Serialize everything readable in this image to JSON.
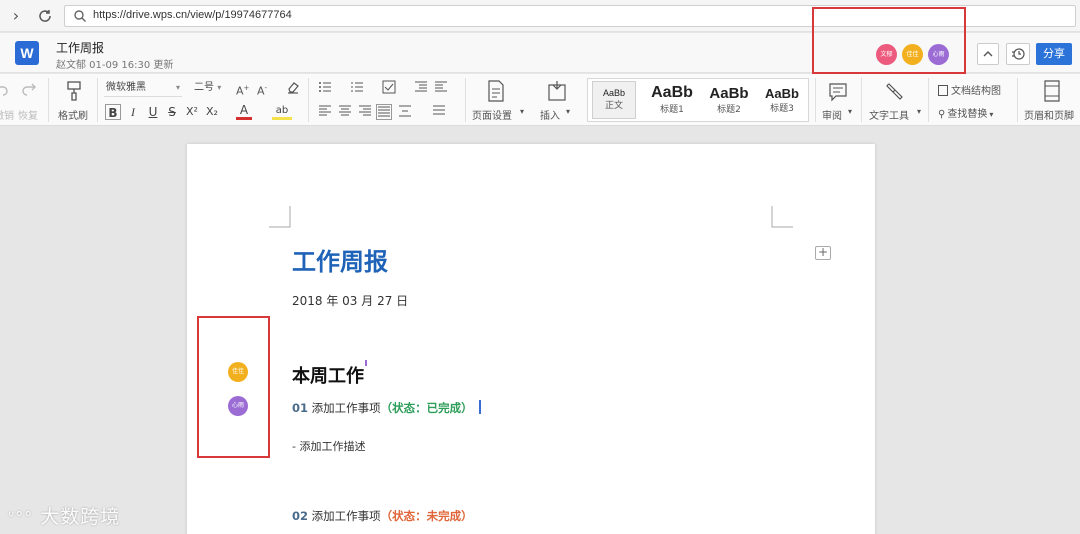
{
  "browser": {
    "url": "https://drive.wps.cn/view/p/19974677764"
  },
  "titlebar": {
    "app_logo": "W",
    "doc_title": "工作周报",
    "doc_meta": "赵文郁 01-09 16:30 更新",
    "share_label": "分享",
    "avatars": [
      {
        "label": "文郁",
        "color": "#ec5b7e"
      },
      {
        "label": "佳佳",
        "color": "#f2b01e"
      },
      {
        "label": "心雨",
        "color": "#9b6cd4"
      }
    ]
  },
  "ribbon": {
    "undo_label": "撤销",
    "redo_label": "恢复",
    "format_painter_label": "格式刷",
    "font_name": "微软雅黑",
    "font_size": "二号",
    "page_setup_label": "页面设置",
    "insert_label": "插入",
    "review_label": "审阅",
    "text_tools_label": "文字工具",
    "doc_structure_label": "文档结构图",
    "find_replace_label": "查找替换",
    "header_footer_label": "页眉和页脚",
    "styles": [
      {
        "preview": "AaBb",
        "name": "正文"
      },
      {
        "preview": "AaBb",
        "name": "标题1"
      },
      {
        "preview": "AaBb",
        "name": "标题2"
      },
      {
        "preview": "AaBb",
        "name": "标题3"
      }
    ]
  },
  "document": {
    "title": "工作周报",
    "date": "2018 年 03 月 27 日",
    "section_heading": "本周工作",
    "items": [
      {
        "num": "01",
        "text": "添加工作事项",
        "status": "（状态：已完成）"
      },
      {
        "num": "02",
        "text": "添加工作事项",
        "status": "（状态：未完成）"
      }
    ],
    "description": "- 添加工作描述",
    "side_avatars": [
      {
        "label": "佳佳",
        "color": "#f2b01e"
      },
      {
        "label": "心雨",
        "color": "#9b6cd4"
      }
    ]
  },
  "watermark": "大数跨境"
}
